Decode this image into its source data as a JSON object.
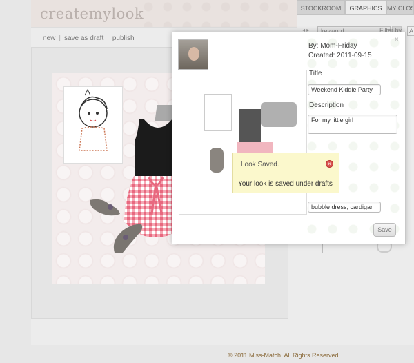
{
  "app": {
    "logo": "createmylook",
    "tabs": [
      {
        "label": "STOCKROOM"
      },
      {
        "label": "GRAPHICS"
      },
      {
        "label": "MY CLOS"
      }
    ]
  },
  "actions": {
    "new": "new",
    "save_draft": "save as draft",
    "publish": "publish",
    "separator": "|"
  },
  "search": {
    "arrows": "◂ ▸",
    "placeholder": "keyword",
    "filter_label": "Filter by",
    "filter_value": "A"
  },
  "popup": {
    "close": "×",
    "by": "By: Mom-Friday",
    "created": "Created: 2011-09-15",
    "title_label": "Title",
    "title_value": "Weekend Kiddie Party",
    "desc_label": "Description",
    "desc_value": "For my little girl",
    "tags_value": "bubble dress, cardigar",
    "save_label": "Save"
  },
  "notice": {
    "title": "Look Saved.",
    "message": "Your look is saved under drafts"
  },
  "footer": "© 2011 Miss-Match. All Rights Reserved.",
  "colors": {
    "notice_bg": "#fbf8cc",
    "gingham": "#f08a9a",
    "footer_text": "#8a6a3a"
  }
}
